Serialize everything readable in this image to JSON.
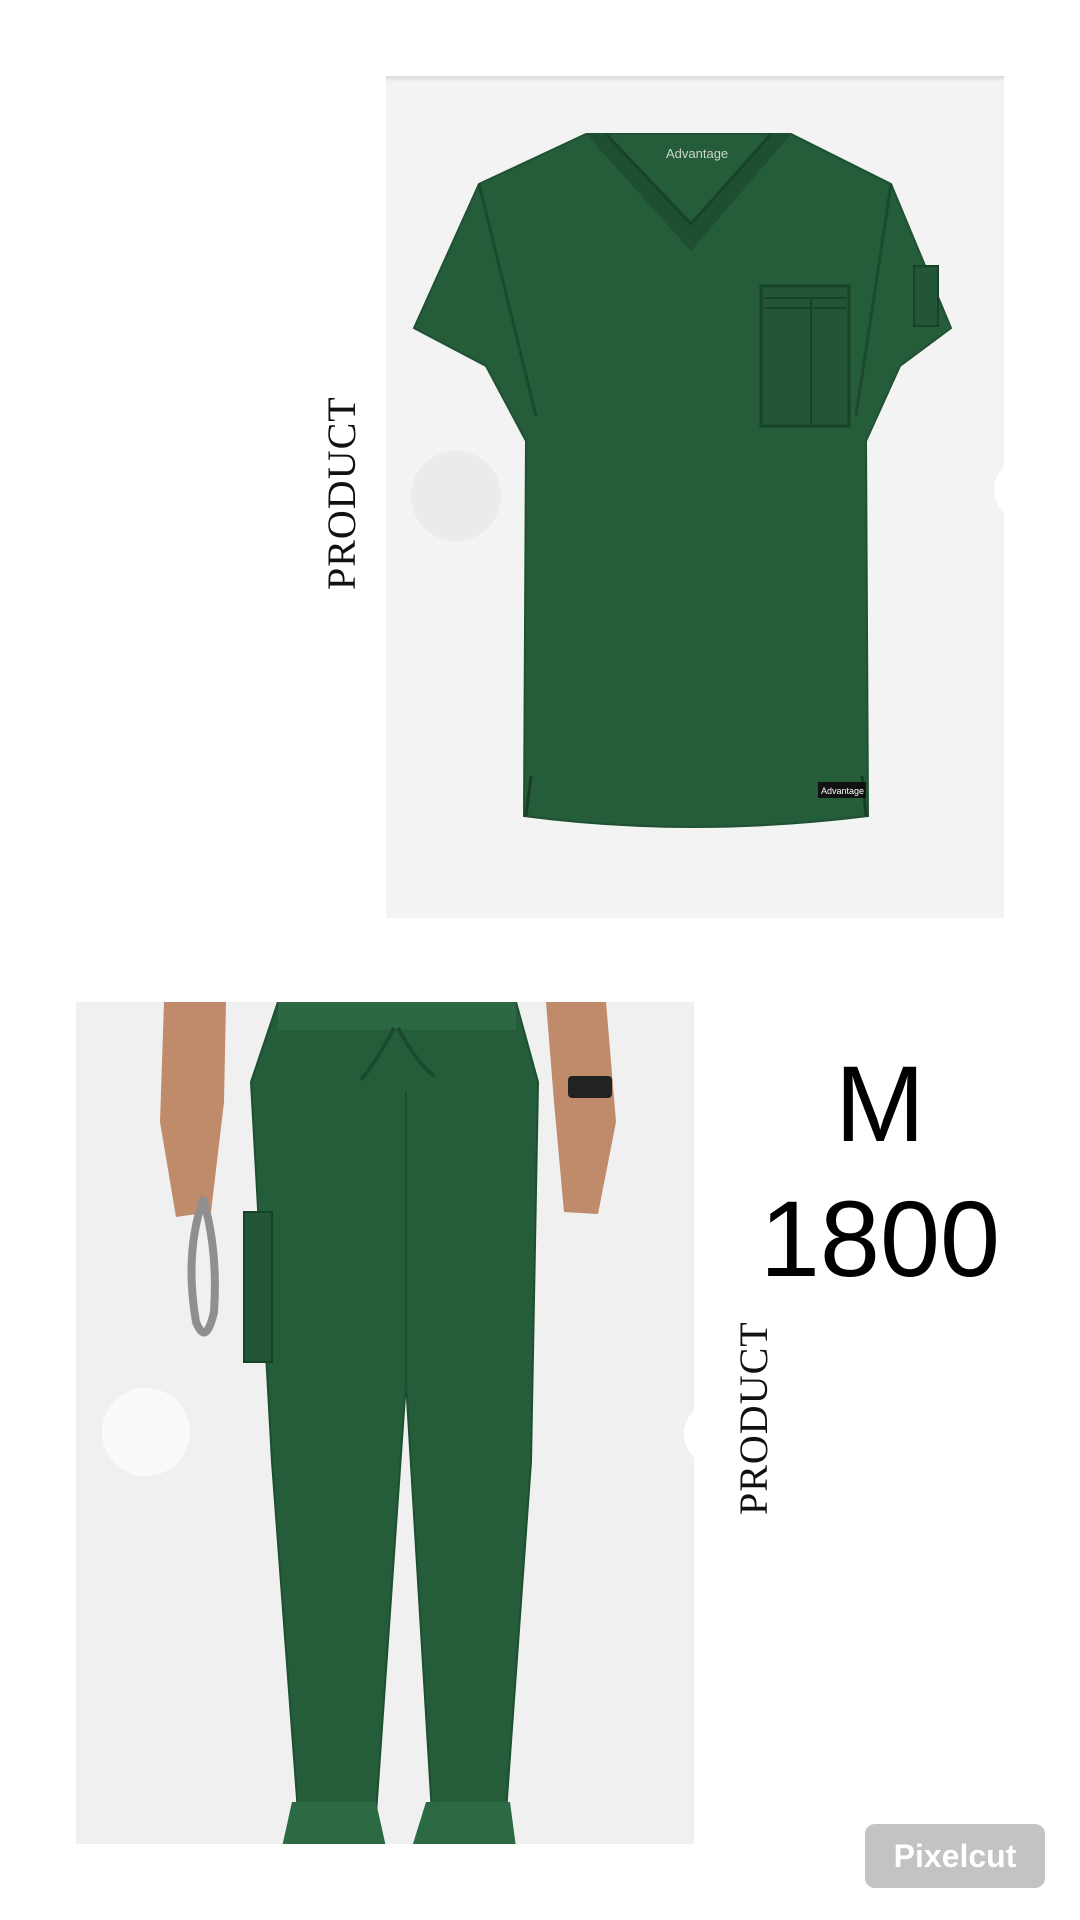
{
  "labels": {
    "product_top": "PRODUCT",
    "product_bottom": "PRODUCT"
  },
  "size": "M",
  "price": "1800",
  "brand_tags": {
    "collar": "Advantage",
    "hem": "Advantage"
  },
  "watermark": "Pixelcut",
  "colors": {
    "scrub_green": "#255c3a",
    "background": "#ffffff",
    "panel_gray": "#f3f3f3",
    "watermark_bg": "#c3c3c3"
  }
}
